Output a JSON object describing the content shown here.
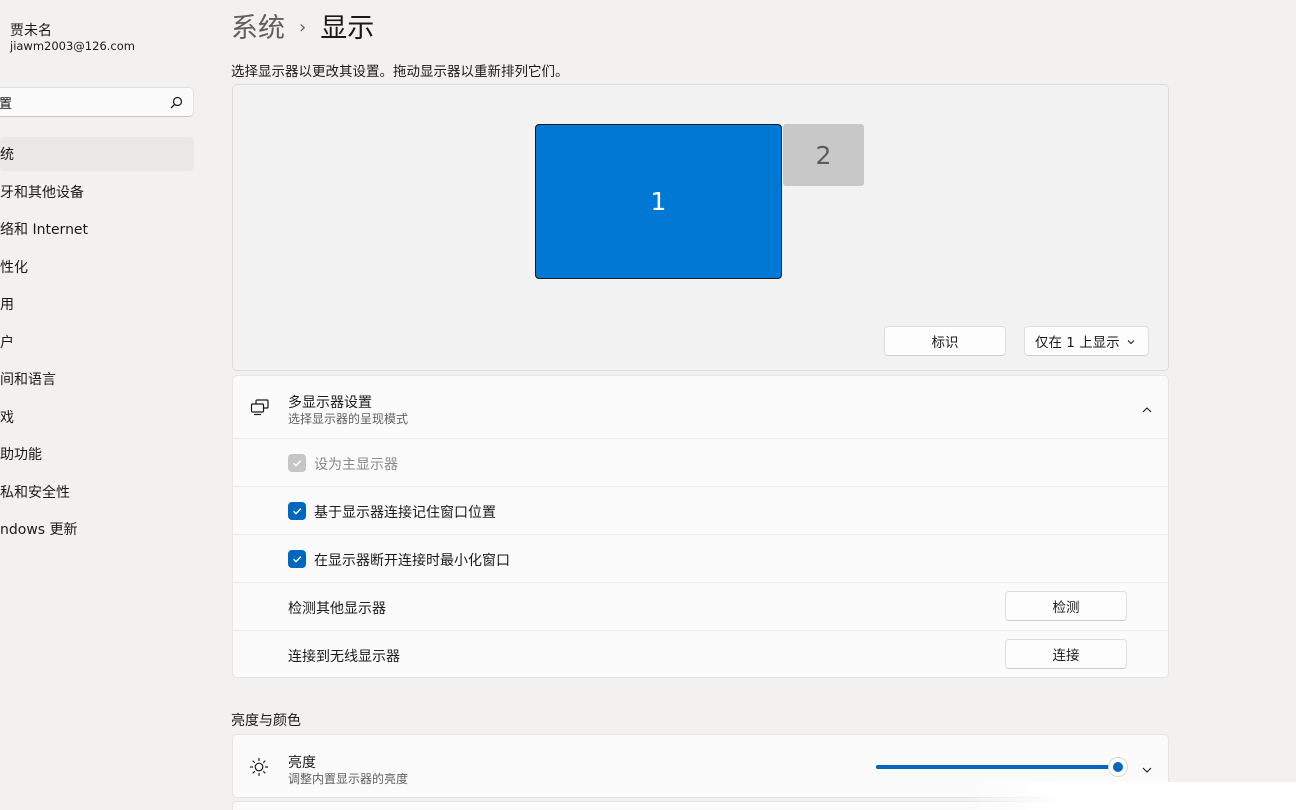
{
  "user": {
    "name": "贾未名",
    "email": "jiawm2003@126.com"
  },
  "search": {
    "value": "置"
  },
  "sidebar": {
    "items": [
      {
        "label": "统",
        "active": true
      },
      {
        "label": "牙和其他设备"
      },
      {
        "label": "络和 Internet"
      },
      {
        "label": "性化"
      },
      {
        "label": "用"
      },
      {
        "label": "户"
      },
      {
        "label": "间和语言"
      },
      {
        "label": "戏"
      },
      {
        "label": "助功能"
      },
      {
        "label": "私和安全性"
      },
      {
        "label": "ndows 更新"
      }
    ]
  },
  "header": {
    "parent": "系统",
    "separator": "›",
    "current": "显示"
  },
  "display_arrangement": {
    "instruction": "选择显示器以更改其设置。拖动显示器以重新排列它们。",
    "monitor_1": "1",
    "monitor_2": "2",
    "identify_button": "标识",
    "mode_select": "仅在 1 上显示",
    "accent": "#0078d4"
  },
  "multi_display": {
    "title": "多显示器设置",
    "subtitle": "选择显示器的呈现模式",
    "rows": {
      "primary": "设为主显示器",
      "remember": "基于显示器连接记住窗口位置",
      "minimize": "在显示器断开连接时最小化窗口",
      "detect_label": "检测其他显示器",
      "detect_button": "检测",
      "wireless_label": "连接到无线显示器",
      "wireless_button": "连接"
    }
  },
  "brightness_section": {
    "title": "亮度与颜色",
    "brightness_title": "亮度",
    "brightness_subtitle": "调整内置显示器的亮度",
    "brightness_level": 1.0
  }
}
